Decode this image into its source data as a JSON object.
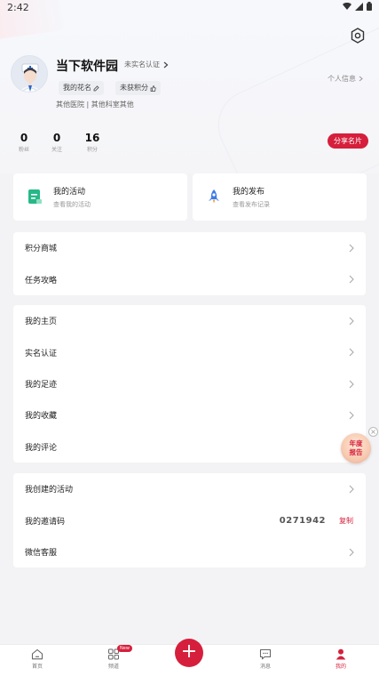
{
  "status_bar": {
    "time": "2:42",
    "icons": [
      "wifi-icon",
      "signal-icon",
      "battery-icon"
    ]
  },
  "profile": {
    "name": "当下软件园",
    "verify_status": "未实名认证",
    "tags": [
      "我的花名",
      "未获积分"
    ],
    "hospital": "其他医院 | 其他科室其他",
    "personal_info": "个人信息"
  },
  "stats": [
    {
      "value": "0",
      "label": "粉丝"
    },
    {
      "value": "0",
      "label": "关注"
    },
    {
      "value": "16",
      "label": "积分"
    }
  ],
  "share_button": "分享名片",
  "cards": [
    {
      "title": "我的活动",
      "subtitle": "查看我的活动",
      "icon": "activity-icon"
    },
    {
      "title": "我的发布",
      "subtitle": "查看发布记录",
      "icon": "rocket-icon"
    }
  ],
  "menu_group1": [
    "积分商城",
    "任务攻略"
  ],
  "menu_group2": [
    "我的主页",
    "实名认证",
    "我的足迹",
    "我的收藏",
    "我的评论"
  ],
  "menu_group3": {
    "created_activities": "我创建的活动",
    "invite_label": "我的邀请码",
    "invite_code": "0271942",
    "copy_label": "复制",
    "wechat_service": "微信客服"
  },
  "year_report": {
    "line1": "年度",
    "line2": "报告"
  },
  "tabbar": {
    "home": "首页",
    "channel": "频道",
    "channel_badge": "New",
    "publish": "+",
    "messages": "消息",
    "mine": "我的"
  },
  "colors": {
    "accent": "#d61f3c",
    "background": "#f3f3f5",
    "card": "#ffffff"
  }
}
